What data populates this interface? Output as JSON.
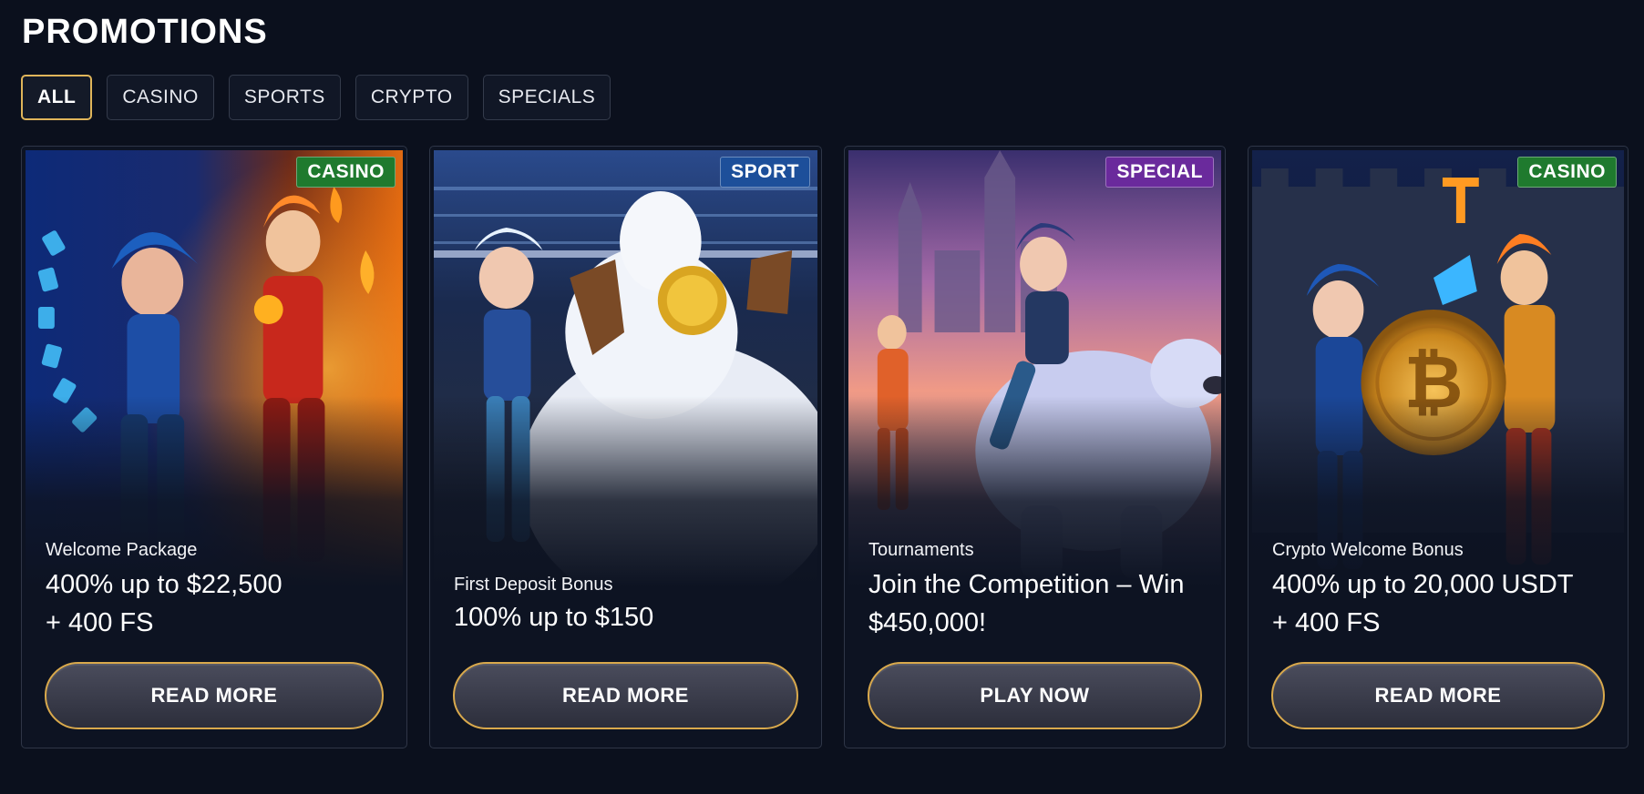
{
  "page": {
    "title": "PROMOTIONS"
  },
  "tabs": [
    {
      "label": "ALL",
      "active": true
    },
    {
      "label": "CASINO",
      "active": false
    },
    {
      "label": "SPORTS",
      "active": false
    },
    {
      "label": "CRYPTO",
      "active": false
    },
    {
      "label": "SPECIALS",
      "active": false
    }
  ],
  "colors": {
    "accent_gold": "#d9a94c",
    "badge_casino": "#1f7a2e",
    "badge_sport": "#1d4f9a",
    "badge_special": "#6a2a9c",
    "background": "#0b101d"
  },
  "cards": [
    {
      "badge": "CASINO",
      "subtitle": "Welcome Package",
      "offer_line1": "400% up to $22,500",
      "offer_line2": "+ 400 FS",
      "button": "READ MORE",
      "art": "jester-mage-duo-casino"
    },
    {
      "badge": "SPORT",
      "subtitle": "First Deposit Bonus",
      "offer_line1": "100% up to $150",
      "offer_line2": "",
      "button": "READ MORE",
      "art": "snowman-stadium"
    },
    {
      "badge": "SPECIAL",
      "subtitle": "Tournaments",
      "offer_line1": "Join the Competition – Win",
      "offer_line2": "$450,000!",
      "button": "PLAY NOW",
      "art": "polar-bear-castle"
    },
    {
      "badge": "CASINO",
      "subtitle": "Crypto Welcome Bonus",
      "offer_line1": "400% up to 20,000 USDT",
      "offer_line2": "+ 400 FS",
      "button": "READ MORE",
      "art": "bitcoin-coin-castle"
    }
  ]
}
